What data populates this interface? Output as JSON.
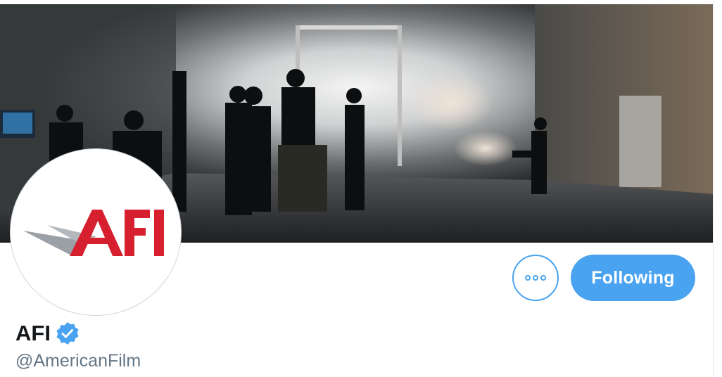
{
  "profile": {
    "display_name": "AFI",
    "handle": "@AmericanFilm",
    "verified": true,
    "avatar_logo_text": "AFI"
  },
  "actions": {
    "more_icon": "more-horizontal-icon",
    "following_label": "Following"
  },
  "colors": {
    "accent": "#4aa3f0",
    "name": "#14171a",
    "handle": "#657786",
    "logo_red": "#d7202f",
    "logo_gray": "#9aa0a6"
  }
}
